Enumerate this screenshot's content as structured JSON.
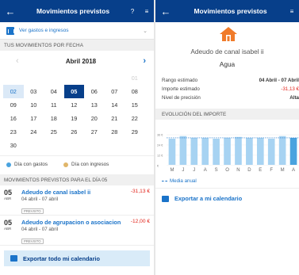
{
  "left": {
    "header": {
      "back": "←",
      "title": "Movimientos previstos",
      "help": "?",
      "menu": "≡"
    },
    "filter": {
      "label": "Ver gastos e ingresos",
      "chevron": "⌄"
    },
    "section_date": "TUS MOVIMIENTOS POR FECHA",
    "month": "Abril 2018",
    "prev": "‹",
    "next": "›",
    "weeks": [
      [
        {
          "d": "",
          "m": 0
        },
        {
          "d": "",
          "m": 0
        },
        {
          "d": "",
          "m": 0
        },
        {
          "d": "",
          "m": 0
        },
        {
          "d": "",
          "m": 0
        },
        {
          "d": "",
          "m": 0
        },
        {
          "d": "01",
          "m": 1
        }
      ],
      [
        {
          "d": "02",
          "s": "sel"
        },
        {
          "d": "03"
        },
        {
          "d": "04"
        },
        {
          "d": "05",
          "s": "today"
        },
        {
          "d": "06"
        },
        {
          "d": "07"
        },
        {
          "d": "08"
        }
      ],
      [
        {
          "d": "09"
        },
        {
          "d": "10"
        },
        {
          "d": "11"
        },
        {
          "d": "12"
        },
        {
          "d": "13"
        },
        {
          "d": "14"
        },
        {
          "d": "15"
        }
      ],
      [
        {
          "d": "16"
        },
        {
          "d": "17"
        },
        {
          "d": "18"
        },
        {
          "d": "19"
        },
        {
          "d": "20"
        },
        {
          "d": "21"
        },
        {
          "d": "22"
        }
      ],
      [
        {
          "d": "23"
        },
        {
          "d": "24"
        },
        {
          "d": "25"
        },
        {
          "d": "26"
        },
        {
          "d": "27"
        },
        {
          "d": "28"
        },
        {
          "d": "29"
        }
      ],
      [
        {
          "d": "30"
        },
        {
          "d": "",
          "m": 0
        },
        {
          "d": "",
          "m": 0
        },
        {
          "d": "",
          "m": 0
        },
        {
          "d": "",
          "m": 0
        },
        {
          "d": "",
          "m": 0
        },
        {
          "d": "",
          "m": 0
        }
      ]
    ],
    "legend": {
      "gastos": "Día con gastos",
      "ingresos": "Día con ingresos",
      "gastos_color": "#4aa3df",
      "ingresos_color": "#e0b66a"
    },
    "section_list": "MOVIMIENTOS PREVISTOS PARA EL DÍA 05",
    "movements": [
      {
        "day": "05",
        "mon": "ABR",
        "name": "Adeudo de canal isabel ii",
        "range": "04 abril - 07 abril",
        "tag": "PREVISTO",
        "amount": "-31,13 €"
      },
      {
        "day": "05",
        "mon": "ABR",
        "name": "Adeudo de agrupacion o asociacion",
        "range": "04 abril - 07 abril",
        "tag": "PREVISTO",
        "amount": "-12,00 €"
      }
    ],
    "export": "Exportar todo mi calendario"
  },
  "right": {
    "header": {
      "back": "←",
      "title": "Movimientos previstos",
      "menu": "≡"
    },
    "name": "Adeudo de canal isabel ii",
    "category": "Agua",
    "info": [
      {
        "k": "Rango estimado",
        "v": "04 Abril - 07 Abril",
        "red": false
      },
      {
        "k": "Importe estimado",
        "v": "-31,13 €",
        "red": true
      },
      {
        "k": "Nivel de precisión",
        "v": "Alta",
        "red": false
      }
    ],
    "section": "EVOLUCIÓN DEL IMPORTE",
    "media": "Media anual",
    "export": "Exportar a mi calendario"
  },
  "chart_data": {
    "type": "bar",
    "categories": [
      "M",
      "J",
      "J",
      "A",
      "S",
      "O",
      "N",
      "D",
      "E",
      "F",
      "M",
      "A"
    ],
    "values": [
      30,
      33,
      31,
      31,
      30,
      31,
      32,
      31,
      31,
      30,
      33,
      31
    ],
    "ytick_labels": [
      "36 €",
      "24 €",
      "12 €",
      "€"
    ],
    "ylim": [
      0,
      40
    ],
    "average": 31,
    "colors": {
      "bar": "#a7d3f2",
      "bar_last": "#4aa3df",
      "avg_line": "#1a73c9"
    }
  }
}
